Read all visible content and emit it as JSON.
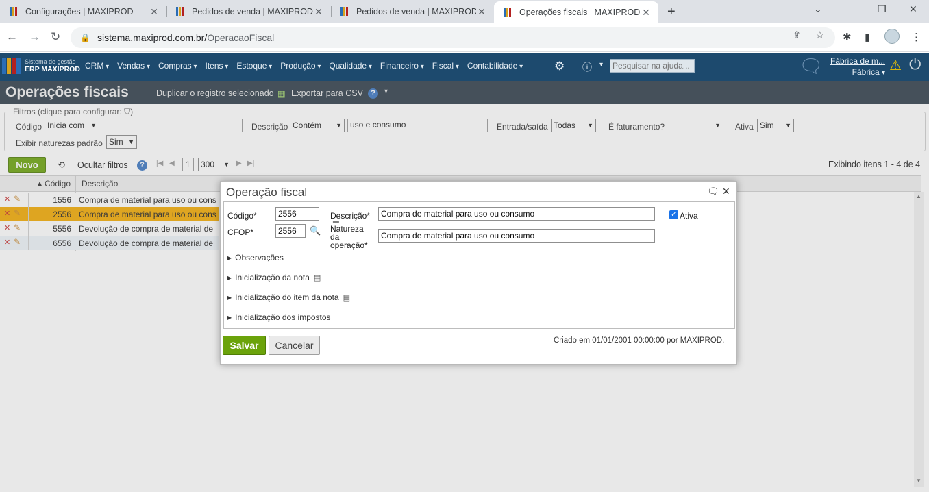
{
  "browser": {
    "tabs": [
      {
        "label": "Configurações | MAXIPROD"
      },
      {
        "label": "Pedidos de venda | MAXIPROD"
      },
      {
        "label": "Pedidos de venda | MAXIPROD"
      },
      {
        "label": "Operações fiscais | MAXIPROD"
      }
    ],
    "url_host": "sistema.maxiprod.com.br/",
    "url_path": "OperacaoFiscal"
  },
  "app": {
    "logo_line1": "Sistema de gestão",
    "logo_line2": "ERP MAXIPROD",
    "menu": [
      "CRM",
      "Vendas",
      "Compras",
      "Itens",
      "Estoque",
      "Produção",
      "Qualidade",
      "Financeiro",
      "Fiscal",
      "Contabilidade"
    ],
    "help_search_placeholder": "Pesquisar na ajuda...",
    "company_name": "Fábrica de m...",
    "company_short": "Fábrica"
  },
  "page": {
    "title": "Operações fiscais",
    "action_duplicate": "Duplicar o registro selecionado",
    "action_export": "Exportar para CSV",
    "help": "?"
  },
  "filters": {
    "legend": "Filtros (clique para configurar:",
    "codigo_label": "Código",
    "codigo_op": "Inicia com",
    "codigo_value": "",
    "descricao_label": "Descrição",
    "descricao_op": "Contém",
    "descricao_value": "uso e consumo",
    "entrada_label": "Entrada/saída",
    "entrada_value": "Todas",
    "faturamento_label": "É faturamento?",
    "faturamento_value": "",
    "ativa_label": "Ativa",
    "ativa_value": "Sim",
    "naturezas_label": "Exibir naturezas padrão",
    "naturezas_value": "Sim"
  },
  "toolbar": {
    "new_label": "Novo",
    "hide_filters": "Ocultar filtros",
    "page": "1",
    "page_size": "300",
    "summary": "Exibindo itens 1 - 4 de 4"
  },
  "grid": {
    "col_codigo": "Código",
    "col_descricao": "Descrição",
    "rows": [
      {
        "codigo": "1556",
        "descricao": "Compra de material para uso ou cons"
      },
      {
        "codigo": "2556",
        "descricao": "Compra de material para uso ou cons"
      },
      {
        "codigo": "5556",
        "descricao": "Devolução de compra de material de"
      },
      {
        "codigo": "6556",
        "descricao": "Devolução de compra de material de"
      }
    ]
  },
  "modal": {
    "title": "Operação fiscal",
    "codigo_label": "Código*",
    "codigo_value": "2556",
    "cfop_label": "CFOP*",
    "cfop_value": "2556",
    "descricao_label": "Descrição*",
    "descricao_value": "Compra de material para uso ou consumo",
    "natureza_label_1": "Natureza",
    "natureza_label_2": "da",
    "natureza_label_3": "operação*",
    "natureza_value": "Compra de material para uso ou consumo",
    "ativa_label": "Ativa",
    "sections": [
      "Observações",
      "Inicialização da nota",
      "Inicialização do item da nota",
      "Inicialização dos impostos"
    ],
    "save_label": "Salvar",
    "cancel_label": "Cancelar",
    "created_info": "Criado em 01/01/2001 00:00:00 por MAXIPROD."
  }
}
